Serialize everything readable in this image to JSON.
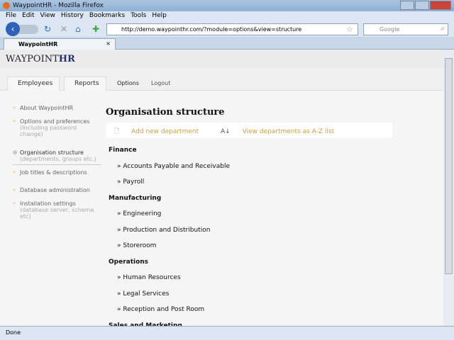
{
  "window": {
    "title": "WaypointHR - Mozilla Firefox"
  },
  "menu": [
    "File",
    "Edit",
    "View",
    "History",
    "Bookmarks",
    "Tools",
    "Help"
  ],
  "url": "http://demo.waypointhr.com/?module=options&view=structure",
  "search_placeholder": "Google",
  "tab": {
    "label": "WaypointHR",
    "close": "×"
  },
  "logo": {
    "text": "WAYPOINT",
    "accent": "HR"
  },
  "nav": {
    "employees": "Employees",
    "reports": "Reports",
    "options": "Options",
    "logout": "Logout"
  },
  "sidebar": [
    {
      "label": "About WaypointHR",
      "sub": ""
    },
    {
      "label": "Options and preferences",
      "sub": "(Including password change)"
    },
    {
      "label": "Organisation structure",
      "sub": "(departments, groups etc.)"
    },
    {
      "label": "Job titles & descriptions",
      "sub": ""
    },
    {
      "label": "Database administration",
      "sub": ""
    },
    {
      "label": "Installation settings",
      "sub": "(database server, schema etc)"
    }
  ],
  "page": {
    "title": "Organisation structure",
    "add": "Add new department",
    "view_az": "View departments as A-Z list"
  },
  "tree": [
    {
      "group": "Finance",
      "items": [
        "Accounts Payable and Receivable",
        "Payroll"
      ]
    },
    {
      "group": "Manufacturing",
      "items": [
        "Engineering",
        "Production and Distribution",
        "Storeroom"
      ]
    },
    {
      "group": "Operations",
      "items": [
        "Human Resources",
        "Legal Services",
        "Reception and Post Room"
      ]
    },
    {
      "group": "Sales and Marketing",
      "items": []
    }
  ],
  "status": "Done"
}
